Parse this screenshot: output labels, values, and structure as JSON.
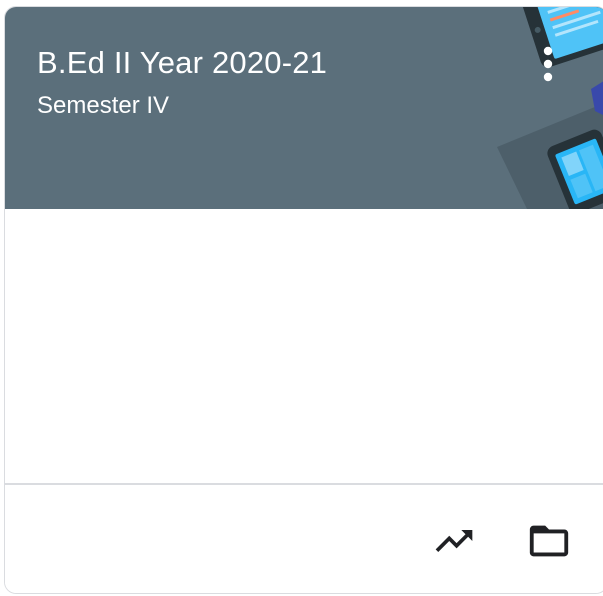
{
  "card": {
    "title": "B.Ed II Year 2020-21",
    "section": "Semester IV",
    "header_color": "#5b6f7b"
  },
  "actions": {
    "more_icon": "more-vert-icon",
    "gradebook_icon": "trending-up-icon",
    "folder_icon": "folder-icon"
  }
}
